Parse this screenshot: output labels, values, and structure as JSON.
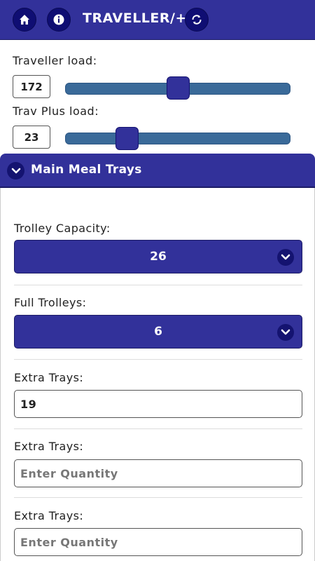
{
  "header": {
    "title": "TRAVELLER/+",
    "home_icon": "home-icon",
    "info_icon": "info-icon",
    "refresh_icon": "refresh-icon",
    "bg_color": "#32319a"
  },
  "loads": {
    "traveller": {
      "label": "Traveller load:",
      "value": "172",
      "slider_fraction": 0.5
    },
    "trav_plus": {
      "label": "Trav Plus load:",
      "value": "23",
      "slider_fraction": 0.25
    }
  },
  "section": {
    "title": "Main Meal Trays",
    "toggle_icon": "chevron-down-icon"
  },
  "fields": {
    "trolley_capacity": {
      "label": "Trolley Capacity:",
      "value": "26"
    },
    "full_trolleys": {
      "label": "Full Trolleys:",
      "value": "6"
    },
    "extra_trays_1": {
      "label": "Extra Trays:",
      "value": "19",
      "placeholder": ""
    },
    "extra_trays_2": {
      "label": "Extra Trays:",
      "value": "",
      "placeholder": "Enter Quantity"
    },
    "extra_trays_3": {
      "label": "Extra Trays:",
      "value": "",
      "placeholder": "Enter Quantity"
    }
  }
}
